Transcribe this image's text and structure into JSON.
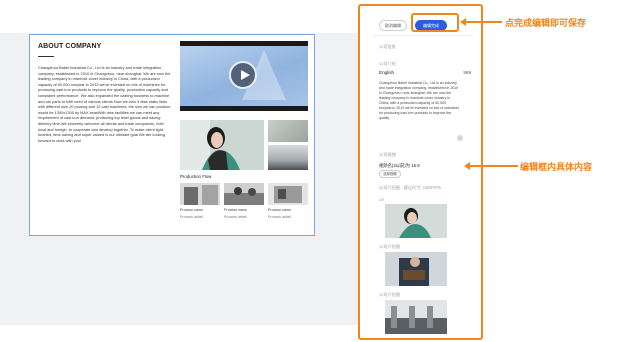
{
  "preview": {
    "title": "ABOUT COMPANY",
    "body": "Changzhou Babel Industrial Co., Ltd is an industry and trade integration company, established in 2010 in Changzhou, near shanghai. We are now the leading company in manhole cover industry in China, with a production capacity of 50,000 ton/year.In 2013 we've invested on lots of machines for producing cast iron products to improve the quality, production capacity and consistent performance. We also expanded the casting business to machine and car parts to fulfil need of various clients.Now we own 3 disa-matic lines with different size 20 pouring and 12 cast machines, the size we can produce would be 1300x1300 by MAX.seasWith new facilities we can meet any requirement of cast iron demand, producing top level goods and saving delivery time.We sincerely welcome all clients and trade companies, both local and foreign, to cooperate and develop together. To make client light-hearted, time-saving and super valued is our ultimate goal.We are looking forward to work with you!",
    "flow_title": "Production Flow",
    "flow": [
      {
        "name": "Process name",
        "detail": "Process detail"
      },
      {
        "name": "Process name",
        "detail": "Process detail"
      },
      {
        "name": "Process name",
        "detail": "Process detail"
      }
    ]
  },
  "editor": {
    "cancel_label": "取消编辑",
    "done_label": "编辑完成",
    "section_company_info": "公司信息",
    "section_intro": "公司介绍",
    "language": "English",
    "char_count": "999",
    "intro_text": "Changzhou Babel Industrial Co., Ltd is an industry and trade integration company, established in 2010 in Changzhou, near shanghai. We are now the leading company in manhole cover industry in China, with a production capacity of 50,000 ton/year.In 2013 we've invested on lots of machines for producing cast iron products to improve the quality",
    "section_video": "公司视频",
    "video_name": "视频名(3以前)为 16.9",
    "choose_label": "选择视频",
    "section_images": "公司介绍图 · 建议尺寸: 1260*675",
    "ratio_label": "2/9",
    "section_image2": "公司介绍图",
    "section_image3": "公司介绍图"
  },
  "annotations": {
    "save_note": "点完成编辑即可保存",
    "content_note": "编辑框内具体内容"
  },
  "colors": {
    "annotation": "#f0861d",
    "primary_button": "#2b5de0",
    "card_border": "#7aa7e0"
  }
}
